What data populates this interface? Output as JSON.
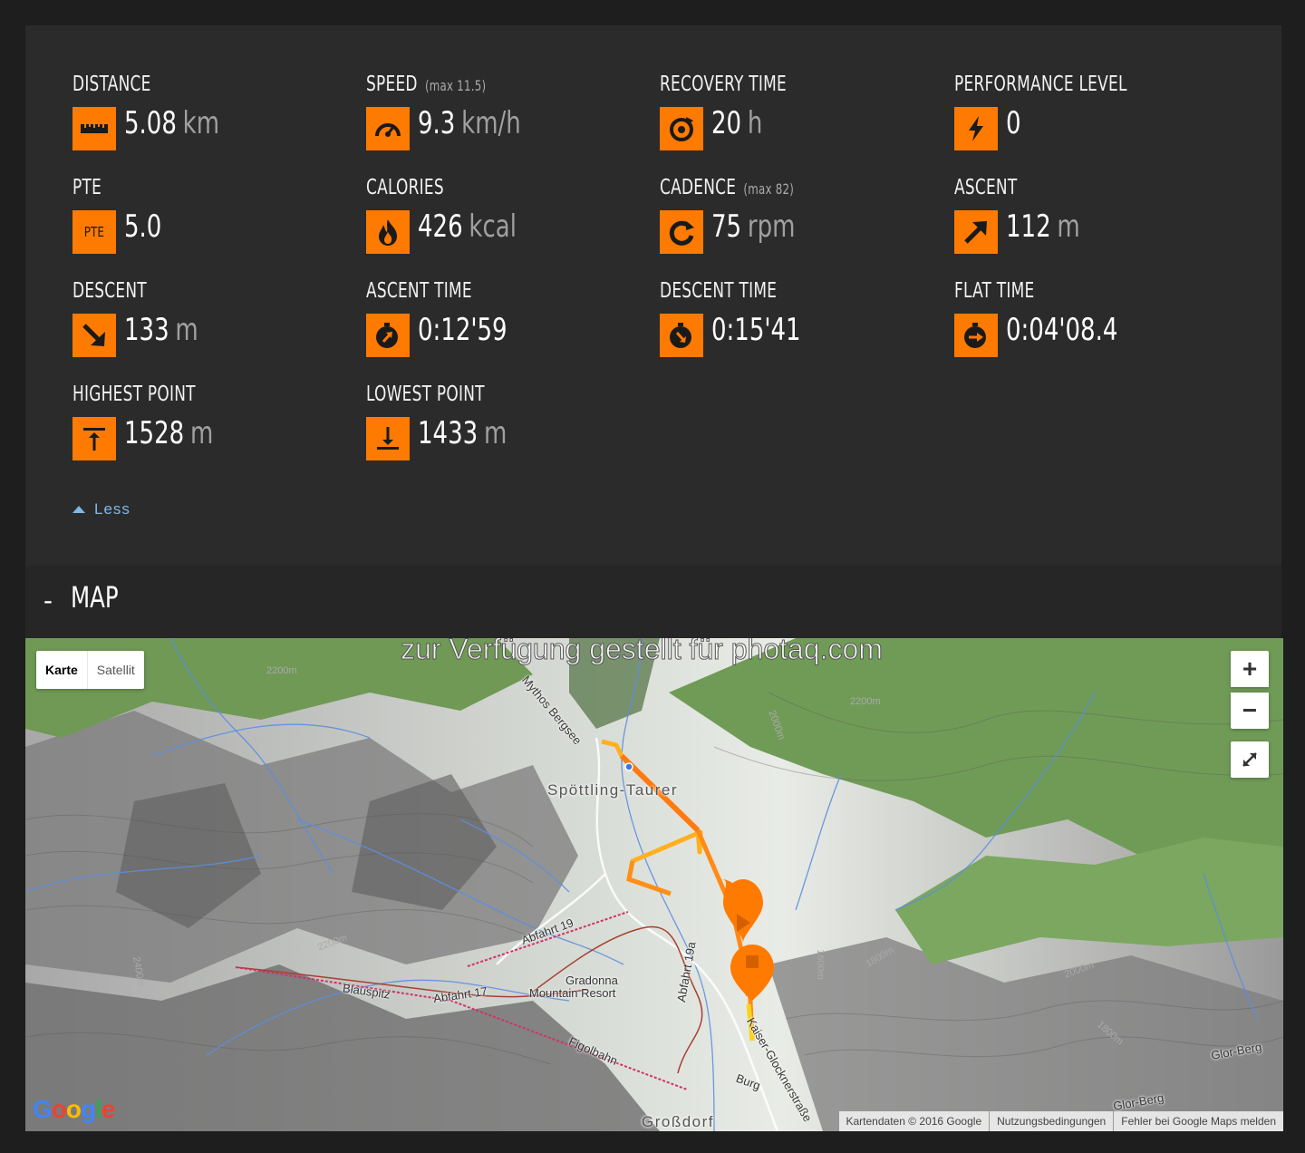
{
  "stats": {
    "distance": {
      "label": "DISTANCE",
      "value": "5.08",
      "unit": "km",
      "icon": "ruler-icon"
    },
    "speed": {
      "label": "SPEED",
      "max": "(max 11.5)",
      "value": "9.3",
      "unit": "km/h",
      "icon": "speedometer-icon"
    },
    "recovery": {
      "label": "RECOVERY TIME",
      "value": "20",
      "unit": "h",
      "icon": "recovery-icon"
    },
    "performance": {
      "label": "PERFORMANCE LEVEL",
      "value": "0",
      "unit": "",
      "icon": "lightning-icon"
    },
    "pte": {
      "label": "PTE",
      "value": "5.0",
      "unit": "",
      "icon_text": "PTE",
      "icon": "pte-icon"
    },
    "calories": {
      "label": "CALORIES",
      "value": "426",
      "unit": "kcal",
      "icon": "flame-icon"
    },
    "cadence": {
      "label": "CADENCE",
      "max": "(max 82)",
      "value": "75",
      "unit": "rpm",
      "icon": "cadence-icon"
    },
    "ascent": {
      "label": "ASCENT",
      "value": "112",
      "unit": "m",
      "icon": "arrow-up-right-icon"
    },
    "descent": {
      "label": "DESCENT",
      "value": "133",
      "unit": "m",
      "icon": "arrow-down-right-icon"
    },
    "ascent_time": {
      "label": "ASCENT TIME",
      "value": "0:12'59",
      "unit": "",
      "icon": "ascent-timer-icon"
    },
    "descent_time": {
      "label": "DESCENT TIME",
      "value": "0:15'41",
      "unit": "",
      "icon": "descent-timer-icon"
    },
    "flat_time": {
      "label": "FLAT TIME",
      "value": "0:04'08.4",
      "unit": "",
      "icon": "flat-timer-icon"
    },
    "highest": {
      "label": "HIGHEST POINT",
      "value": "1528",
      "unit": "m",
      "icon": "highest-point-icon"
    },
    "lowest": {
      "label": "LOWEST POINT",
      "value": "1433",
      "unit": "m",
      "icon": "lowest-point-icon"
    }
  },
  "less_label": "Less",
  "map_section": {
    "dash": "-",
    "title": "MAP"
  },
  "map": {
    "type_active": "Karte",
    "type_inactive": "Satellit",
    "zoom_in": "+",
    "zoom_out": "−",
    "watermark": "zur Verfügung gestellt für photaq.com",
    "labels": {
      "place1": "Spöttling-Taurer",
      "place2": "Großdorf",
      "gradonna": "Gradonna",
      "resort": "Mountain Resort",
      "abfahrt19": "Abfahrt 19",
      "abfahrt17": "Abfahrt 17",
      "abfahrt19a": "Abfahrt 19a",
      "blauspitz": "Blauspitz",
      "figolbahn": "Figolbahn",
      "mythos": "Mythos Bergsee",
      "kaiser": "Kaiser-Glocknerstraße",
      "burg": "Burg",
      "glor1": "Glor-Berg",
      "glor2": "Glor-Berg",
      "c2200a": "2200m",
      "c2200b": "2200m",
      "c2000a": "2000m",
      "c1800a": "1800m",
      "c1600a": "1600m",
      "c2400": "2400m",
      "c2200c": "2200m",
      "c1800b": "1800m",
      "c2000b": "2000m"
    },
    "google": "Google",
    "attribution": {
      "data": "Kartendaten © 2016 Google",
      "terms": "Nutzungsbedingungen",
      "report": "Fehler bei Google Maps melden"
    },
    "route_color": "#ff9a1f",
    "route_fast_color": "#e53030",
    "marker_color": "#ff7a00"
  },
  "colors": {
    "accent": "#ff7a00",
    "panel": "#2b2b2b",
    "link": "#7fb8e8"
  }
}
